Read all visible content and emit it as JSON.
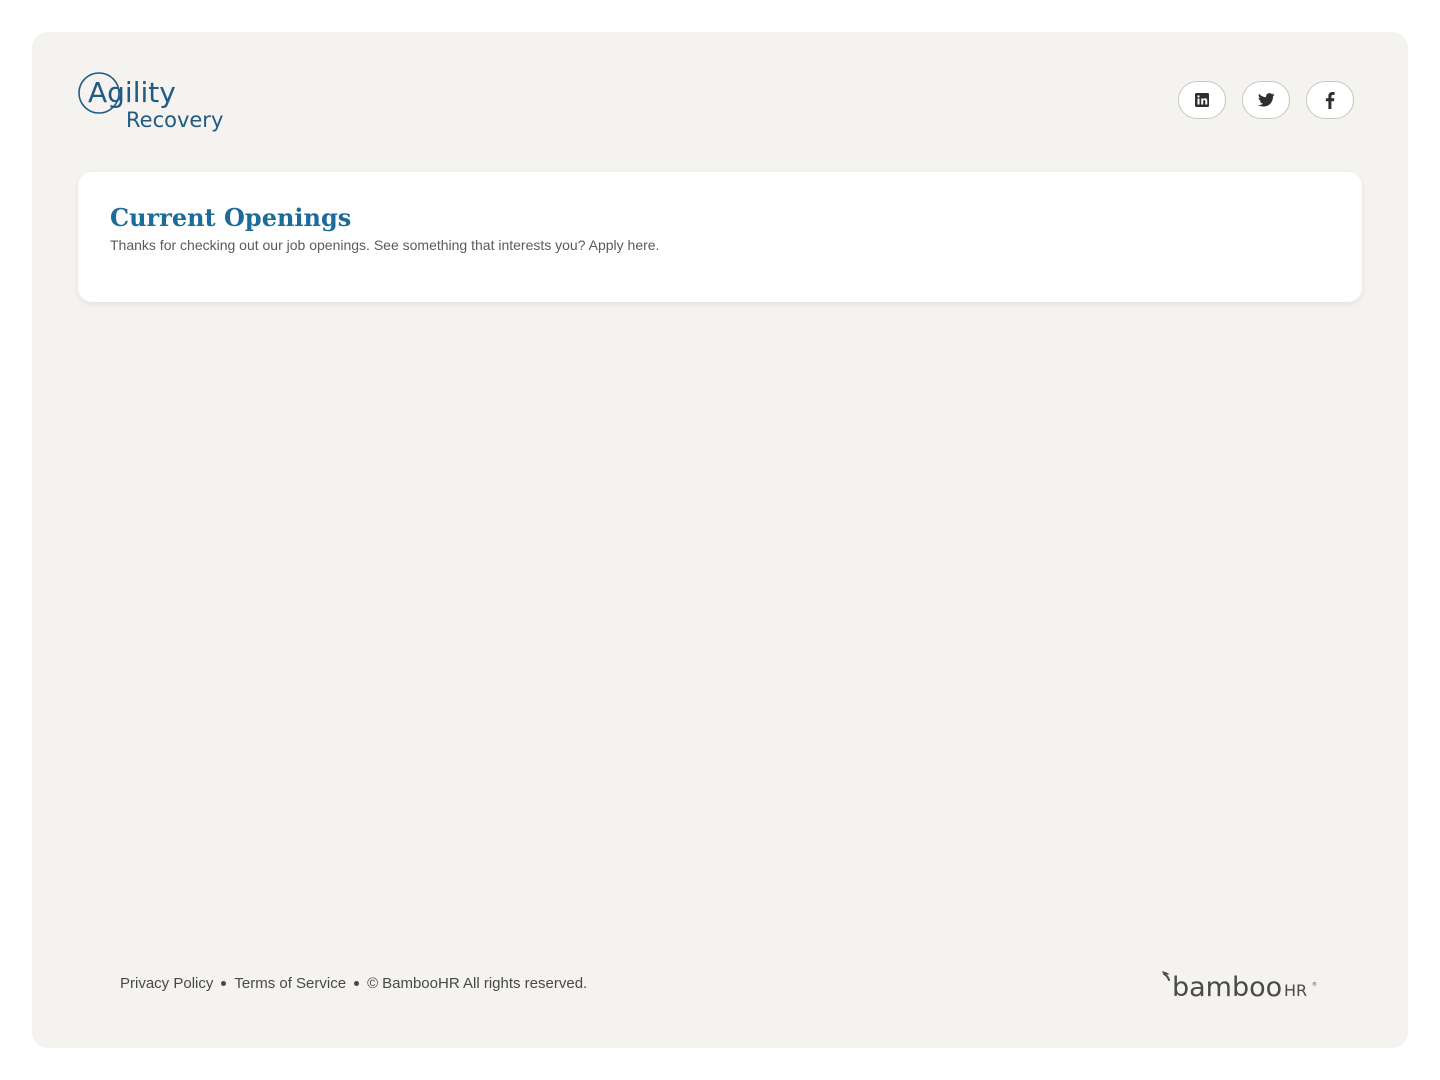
{
  "brand": {
    "logo_line1": "Agility",
    "logo_line2": "Recovery",
    "brand_color": "#1f5b82"
  },
  "social": [
    {
      "icon": "linkedin-icon"
    },
    {
      "icon": "twitter-icon"
    },
    {
      "icon": "facebook-icon"
    }
  ],
  "main": {
    "title": "Current Openings",
    "subtitle": "Thanks for checking out our job openings. See something that interests you? Apply here.",
    "title_color": "#1c6c99"
  },
  "footer": {
    "privacy_label": "Privacy Policy",
    "terms_label": "Terms of Service",
    "copyright_symbol": "©",
    "copyright_text": "BambooHR All rights reserved.",
    "powered_by_main": "bamboo",
    "powered_by_suffix": "HR"
  },
  "colors": {
    "page_bg": "#f5f3f0",
    "card_bg": "#ffffff",
    "text_muted": "#5d5b58"
  }
}
